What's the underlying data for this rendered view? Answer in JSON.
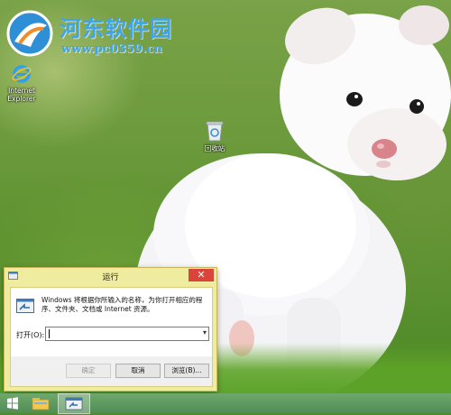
{
  "watermark": {
    "title": "河东软件园",
    "url": "www.pc0359.cn"
  },
  "desktop": {
    "icons": [
      {
        "label_line1": "Internet",
        "label_line2": "Explorer",
        "icon": "internet-explorer-icon"
      },
      {
        "label": "回收站",
        "icon": "recycle-bin-icon"
      }
    ]
  },
  "run_dialog": {
    "title": "运行",
    "description": "Windows 将根据你所输入的名称，为你打开相应的程序、文件夹、文档或 Internet 资源。",
    "open_label": "打开(O):",
    "open_value": "",
    "buttons": {
      "ok": "确定",
      "cancel": "取消",
      "browse": "浏览(B)..."
    },
    "close_symbol": "✕"
  },
  "taskbar": {
    "items": [
      "start-icon",
      "file-explorer-icon",
      "run-icon"
    ]
  },
  "colors": {
    "dialog_frame": "#f0ec9f",
    "close_button": "#d9453a",
    "watermark_blue": "#3fa4e8",
    "taskbar": "#5a9a5e"
  }
}
